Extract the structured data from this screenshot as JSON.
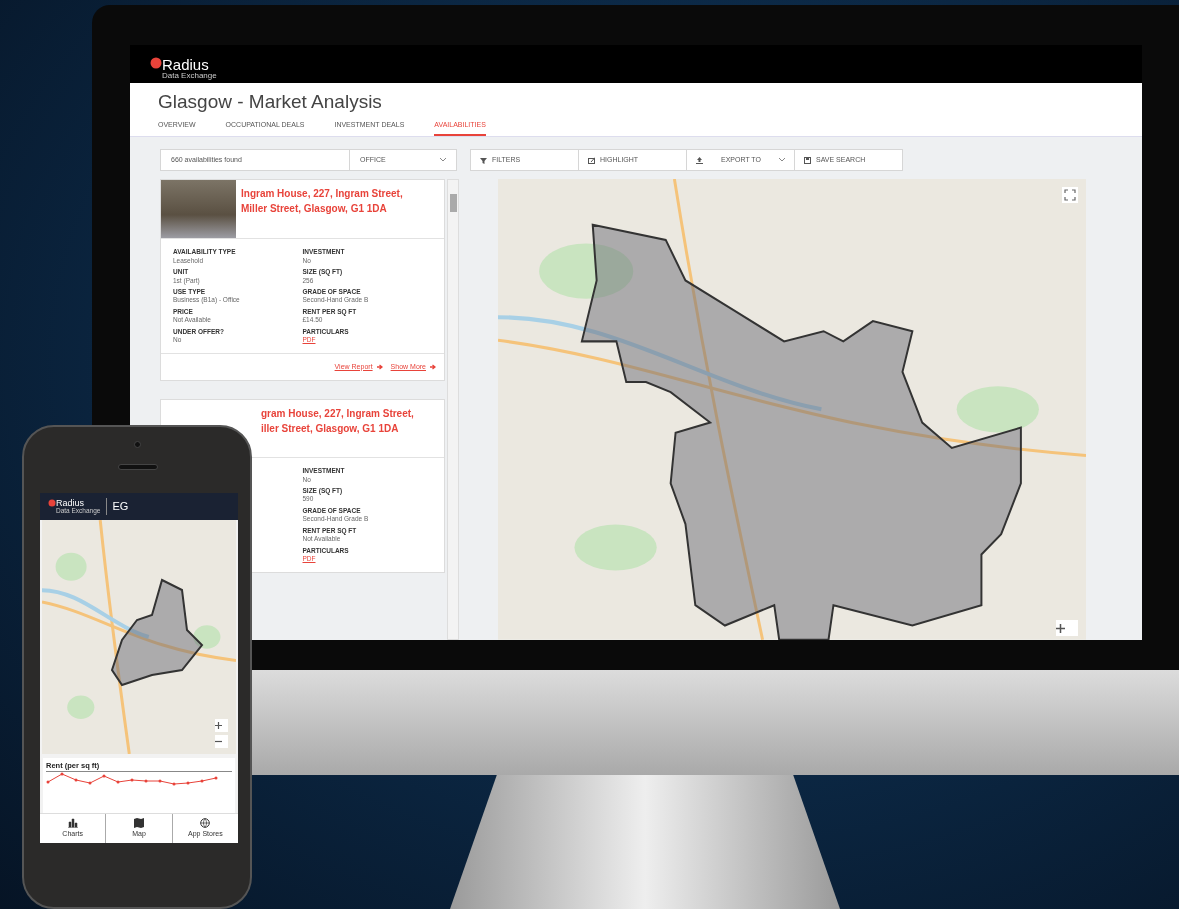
{
  "app": {
    "logo_name": "Radius",
    "logo_sub": "Data Exchange"
  },
  "page_title": "Glasgow - Market Analysis",
  "tabs": [
    {
      "label": "OVERVIEW",
      "selected": false
    },
    {
      "label": "OCCUPATIONAL DEALS",
      "selected": false
    },
    {
      "label": "INVESTMENT DEALS",
      "selected": false
    },
    {
      "label": "AVAILABILITIES",
      "selected": true
    }
  ],
  "toolbar": {
    "results": "660 availabilities found",
    "type_select": "OFFICE",
    "buttons": [
      {
        "label": "FILTERS",
        "kind": "filter",
        "dropdown": false
      },
      {
        "label": "HIGHLIGHT",
        "kind": "highlight",
        "dropdown": false
      },
      {
        "label": "EXPORT TO",
        "kind": "export",
        "dropdown": true
      },
      {
        "label": "SAVE SEARCH",
        "kind": "save",
        "dropdown": false
      }
    ]
  },
  "listings": [
    {
      "title_lines": [
        "Ingram House, 227, Ingram Street,",
        "Miller Street, Glasgow, G1 1DA"
      ],
      "has_photo": true,
      "left": [
        {
          "label": "AVAILABILITY TYPE",
          "value": "Leasehold",
          "kind": "text"
        },
        {
          "label": "UNIT",
          "value": "1st (Part)",
          "kind": "text"
        },
        {
          "label": "USE TYPE",
          "value": "Business (B1a) - Office",
          "kind": "text"
        },
        {
          "label": "PRICE",
          "value": "Not Available",
          "kind": "text"
        },
        {
          "label": "UNDER OFFER?",
          "value": "No",
          "kind": "text"
        }
      ],
      "right": [
        {
          "label": "INVESTMENT",
          "value": "No",
          "kind": "text"
        },
        {
          "label": "SIZE (SQ FT)",
          "value": "256",
          "kind": "text"
        },
        {
          "label": "GRADE OF SPACE",
          "value": "Second-Hand Grade B",
          "kind": "text"
        },
        {
          "label": "RENT PER SQ FT",
          "value": "£14.50",
          "kind": "text"
        },
        {
          "label": "PARTICULARS",
          "value": "PDF",
          "kind": "link"
        }
      ],
      "links": [
        "View Report",
        "Show More"
      ]
    },
    {
      "title_lines": [
        "gram House, 227, Ingram Street,",
        "iller Street, Glasgow, G1 1DA"
      ],
      "has_photo": false,
      "right": [
        {
          "label": "INVESTMENT",
          "value": "No",
          "kind": "text"
        },
        {
          "label": "SIZE (SQ FT)",
          "value": "590",
          "kind": "text"
        },
        {
          "label": "GRADE OF SPACE",
          "value": "Second-Hand Grade B",
          "kind": "text"
        },
        {
          "label": "RENT PER SQ FT",
          "value": "Not Available",
          "kind": "text"
        },
        {
          "label": "PARTICULARS",
          "value": "PDF",
          "kind": "link"
        }
      ]
    }
  ],
  "phone": {
    "logo_name": "Radius",
    "logo_sub": "Data Exchange",
    "partner": "EG",
    "chart_title": "Rent (per sq ft)",
    "nav": [
      {
        "label": "Charts",
        "kind": "chart"
      },
      {
        "label": "Map",
        "kind": "map"
      },
      {
        "label": "App Stores",
        "kind": "store"
      }
    ]
  }
}
